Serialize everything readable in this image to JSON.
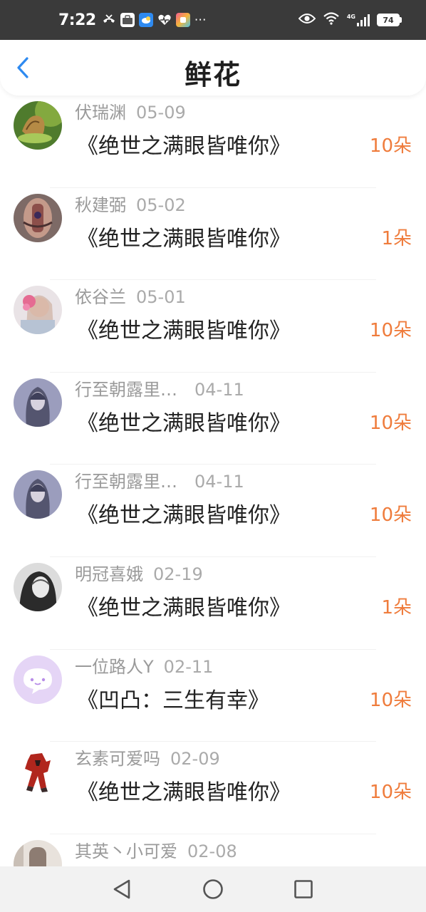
{
  "status_bar": {
    "time": "7:22",
    "icons": [
      "missed-call-icon",
      "app-box-icon",
      "weather-app-icon",
      "health-icon",
      "photo-app-icon",
      "more-dots-icon"
    ],
    "right_icons": [
      "eye-icon",
      "wifi-icon",
      "signal-icon",
      "battery-icon"
    ],
    "network": "4G",
    "battery": "74"
  },
  "header": {
    "title": "鲜花",
    "accent_color": "#2e8af0"
  },
  "records": [
    {
      "name": "伏瑞渊",
      "date": "05-09",
      "gift": "《绝世之满眼皆唯你》",
      "count": "10朵",
      "avatar": "butterfly-avatar"
    },
    {
      "name": "秋建弼",
      "date": "05-02",
      "gift": "《绝世之满眼皆唯你》",
      "count": "1朵",
      "avatar": "hands-avatar"
    },
    {
      "name": "依谷兰",
      "date": "05-01",
      "gift": "《绝世之满眼皆唯你》",
      "count": "10朵",
      "avatar": "girl-flower-avatar"
    },
    {
      "name": "行至朝露里…",
      "date": "04-11",
      "gift": "《绝世之满眼皆唯你》",
      "count": "10朵",
      "avatar": "anime-girl-avatar"
    },
    {
      "name": "行至朝露里…",
      "date": "04-11",
      "gift": "《绝世之满眼皆唯你》",
      "count": "10朵",
      "avatar": "anime-girl-avatar"
    },
    {
      "name": "明冠喜娥",
      "date": "02-19",
      "gift": "《绝世之满眼皆唯你》",
      "count": "1朵",
      "avatar": "bw-portrait-avatar"
    },
    {
      "name": "一位路人Y",
      "date": "02-11",
      "gift": "《凹凸：三生有幸》",
      "count": "10朵",
      "avatar": "default-chat-avatar"
    },
    {
      "name": "玄素可爱吗",
      "date": "02-09",
      "gift": "《绝世之满眼皆唯你》",
      "count": "10朵",
      "avatar": "red-robot-avatar"
    },
    {
      "name": "其英丶小可爱",
      "date": "02-08",
      "gift": "",
      "count": "",
      "avatar": "photo-avatar"
    }
  ],
  "colors": {
    "count": "#ef7c3c",
    "name": "#9a9a9a",
    "gift": "#222222"
  },
  "nav": {
    "back": "back-triangle-icon",
    "home": "home-circle-icon",
    "recent": "recent-square-icon"
  }
}
